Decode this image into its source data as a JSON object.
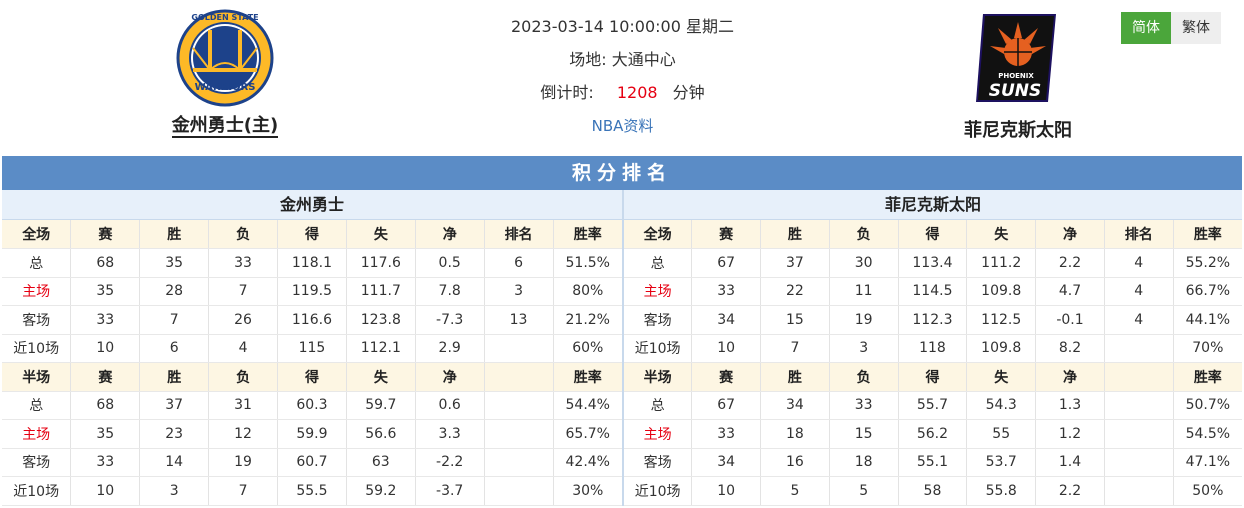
{
  "home": {
    "name": "金州勇士(主)",
    "logo_icon": "warriors-logo-icon",
    "logo_text_top": "GOLDEN STATE",
    "logo_text_bottom": "WARRIORS"
  },
  "away": {
    "name": "菲尼克斯太阳",
    "logo_icon": "suns-logo-icon",
    "logo_text_top": "PHOENIX",
    "logo_text_bottom": "SUNS"
  },
  "match": {
    "datetime": "2023-03-14 10:00:00 星期二",
    "venue_label": "场地:",
    "venue": "大通中心",
    "countdown_label": "倒计时:",
    "countdown_value": "1208",
    "countdown_unit": "分钟",
    "link": "NBA资料"
  },
  "lang": {
    "simplified": "简体",
    "traditional": "繁体"
  },
  "standings": {
    "title": "积分排名",
    "home_team": "金州勇士",
    "away_team": "菲尼克斯太阳",
    "home_rows": [
      [
        "全场",
        "赛",
        "胜",
        "负",
        "得",
        "失",
        "净",
        "排名",
        "胜率"
      ],
      [
        "总",
        "68",
        "35",
        "33",
        "118.1",
        "117.6",
        "0.5",
        "6",
        "51.5%"
      ],
      [
        "主场",
        "35",
        "28",
        "7",
        "119.5",
        "111.7",
        "7.8",
        "3",
        "80%"
      ],
      [
        "客场",
        "33",
        "7",
        "26",
        "116.6",
        "123.8",
        "-7.3",
        "13",
        "21.2%"
      ],
      [
        "近10场",
        "10",
        "6",
        "4",
        "115",
        "112.1",
        "2.9",
        "",
        "60%"
      ],
      [
        "半场",
        "赛",
        "胜",
        "负",
        "得",
        "失",
        "净",
        "",
        "胜率"
      ],
      [
        "总",
        "68",
        "37",
        "31",
        "60.3",
        "59.7",
        "0.6",
        "",
        "54.4%"
      ],
      [
        "主场",
        "35",
        "23",
        "12",
        "59.9",
        "56.6",
        "3.3",
        "",
        "65.7%"
      ],
      [
        "客场",
        "33",
        "14",
        "19",
        "60.7",
        "63",
        "-2.2",
        "",
        "42.4%"
      ],
      [
        "近10场",
        "10",
        "3",
        "7",
        "55.5",
        "59.2",
        "-3.7",
        "",
        "30%"
      ]
    ],
    "away_rows": [
      [
        "全场",
        "赛",
        "胜",
        "负",
        "得",
        "失",
        "净",
        "排名",
        "胜率"
      ],
      [
        "总",
        "67",
        "37",
        "30",
        "113.4",
        "111.2",
        "2.2",
        "4",
        "55.2%"
      ],
      [
        "主场",
        "33",
        "22",
        "11",
        "114.5",
        "109.8",
        "4.7",
        "4",
        "66.7%"
      ],
      [
        "客场",
        "34",
        "15",
        "19",
        "112.3",
        "112.5",
        "-0.1",
        "4",
        "44.1%"
      ],
      [
        "近10场",
        "10",
        "7",
        "3",
        "118",
        "109.8",
        "8.2",
        "",
        "70%"
      ],
      [
        "半场",
        "赛",
        "胜",
        "负",
        "得",
        "失",
        "净",
        "",
        "胜率"
      ],
      [
        "总",
        "67",
        "34",
        "33",
        "55.7",
        "54.3",
        "1.3",
        "",
        "50.7%"
      ],
      [
        "主场",
        "33",
        "18",
        "15",
        "56.2",
        "55",
        "1.2",
        "",
        "54.5%"
      ],
      [
        "客场",
        "34",
        "16",
        "18",
        "55.1",
        "53.7",
        "1.4",
        "",
        "47.1%"
      ],
      [
        "近10场",
        "10",
        "5",
        "5",
        "58",
        "55.8",
        "2.2",
        "",
        "50%"
      ]
    ]
  },
  "colors": {
    "banner": "#5b8cc6",
    "accent_red": "#e60012",
    "active_green": "#4ba63b",
    "link_blue": "#3a74b8"
  }
}
